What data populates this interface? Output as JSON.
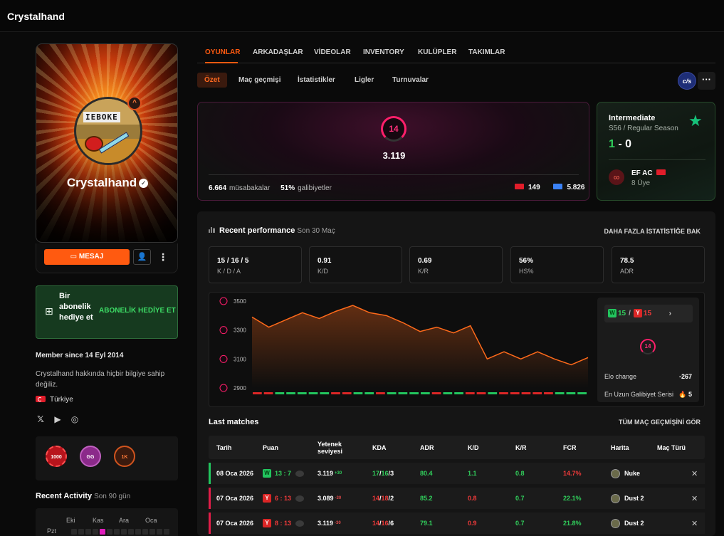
{
  "app": {
    "title": "Crystalhand"
  },
  "profile": {
    "name": "Crystalhand",
    "message_label": "MESAJ",
    "avatar_text": "IEBOKE",
    "rank_icon": "chevron-rank-icon"
  },
  "gift": {
    "text": "Bir abonelik hediye et",
    "button": "ABONELİK HEDİYE ET"
  },
  "member_since": "Member since 14 Eyl 2014",
  "about": "Crystalhand hakkında hiçbir bilgiye sahip değiliz.",
  "country": "Türkiye",
  "socials": [
    "x-icon",
    "youtube-icon",
    "steam-icon"
  ],
  "badges": [
    {
      "label": "1000",
      "color": "#b8141c"
    },
    {
      "label": "GG",
      "color": "#8b2a8a"
    },
    {
      "label": "1K",
      "color": "#d1541e"
    }
  ],
  "recent_activity": {
    "title": "Recent Activity",
    "subtitle": "Son 90 gün",
    "months": [
      "Eki",
      "Kas",
      "Ara",
      "Oca"
    ],
    "day_label": "Pzt"
  },
  "tabs": [
    "OYUNLAR",
    "ARKADAŞLAR",
    "VİDEOLAR",
    "INVENTORY",
    "KULÜPLER",
    "TAKIMLAR"
  ],
  "subtabs": [
    "Özet",
    "Maç geçmişi",
    "İstatistikler",
    "Ligler",
    "Turnuvalar"
  ],
  "game_badge": "c/s",
  "elo": {
    "level": "14",
    "value": "3.119",
    "matches": "6.664",
    "matches_label": "müsabakalar",
    "winrate": "51%",
    "winrate_label": "galibiyetler",
    "country_rank": "149",
    "region_rank": "5.826"
  },
  "league": {
    "title": "Intermediate",
    "season": "S56 / Regular Season",
    "score_w": "1",
    "score_sep": " - ",
    "score_l": "0",
    "club": "EF AC",
    "members": "8 Üye"
  },
  "performance": {
    "title": "Recent performance",
    "subtitle": "Son 30 Maç",
    "more": "DAHA FAZLA İSTATİSTİĞE BAK",
    "stats": [
      {
        "value": "15 / 16 / 5",
        "label": "K / D / A"
      },
      {
        "value": "0.91",
        "label": "K/D"
      },
      {
        "value": "0.69",
        "label": "K/R"
      },
      {
        "value": "56%",
        "label": "HS%"
      },
      {
        "value": "78.5",
        "label": "ADR"
      }
    ],
    "wins": "15",
    "losses": "15",
    "win_tag": "W",
    "loss_tag": "Y",
    "level": "14",
    "elo_change_label": "Elo change",
    "elo_change": "-267",
    "streak_label": "En Uzun Galibiyet Serisi",
    "streak": "5"
  },
  "chart_data": {
    "type": "line",
    "y_ticks": [
      "3500",
      "3300",
      "3100",
      "2900"
    ],
    "ylim": [
      2900,
      3500
    ],
    "values": [
      3390,
      3320,
      3370,
      3420,
      3380,
      3430,
      3470,
      3420,
      3400,
      3350,
      3290,
      3320,
      3280,
      3330,
      3100,
      3150,
      3100,
      3150,
      3100,
      3060,
      3110
    ],
    "results": [
      "l",
      "l",
      "g",
      "g",
      "g",
      "g",
      "g",
      "l",
      "l",
      "g",
      "g",
      "l",
      "g",
      "g",
      "g",
      "g",
      "l",
      "g",
      "g",
      "l",
      "l",
      "g",
      "l",
      "l",
      "l",
      "l",
      "l",
      "g",
      "g",
      "g"
    ]
  },
  "last_matches": {
    "title": "Last matches",
    "all": "TÜM MAÇ GEÇMİŞİNİ GÖR",
    "headers": [
      "Tarih",
      "Puan",
      "Yetenek seviyesi",
      "KDA",
      "ADR",
      "K/D",
      "K/R",
      "FCR",
      "Harita",
      "Maç Türü"
    ],
    "rows": [
      {
        "date": "08 Oca 2026",
        "result": "W",
        "score": "13 : 7",
        "elo": "3.119",
        "delta": "+30",
        "k": "17",
        "d": "16",
        "a": "3",
        "adr": "80.4",
        "kd": "1.1",
        "kr": "0.8",
        "fcr": "14.7%",
        "map": "Nuke"
      },
      {
        "date": "07 Oca 2026",
        "result": "Y",
        "score": "6 : 13",
        "elo": "3.089",
        "delta": "-30",
        "k": "14",
        "d": "18",
        "a": "2",
        "adr": "85.2",
        "kd": "0.8",
        "kr": "0.7",
        "fcr": "22.1%",
        "map": "Dust 2"
      },
      {
        "date": "07 Oca 2026",
        "result": "Y",
        "score": "8 : 13",
        "elo": "3.119",
        "delta": "-30",
        "k": "14",
        "d": "16",
        "a": "6",
        "adr": "79.1",
        "kd": "0.9",
        "kr": "0.7",
        "fcr": "21.8%",
        "map": "Dust 2"
      }
    ]
  }
}
